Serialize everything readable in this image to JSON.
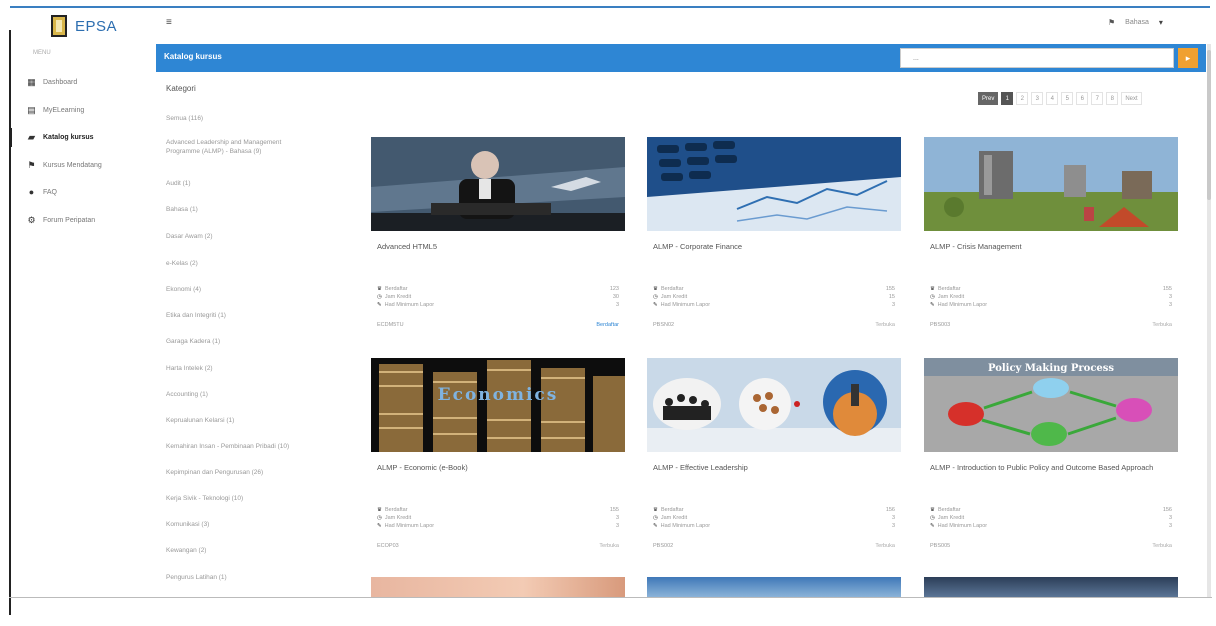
{
  "brand": {
    "name": "EPSA",
    "subtitle": "MENU"
  },
  "nav": [
    {
      "label": "Dashboard",
      "icon": "dashboard-icon",
      "glyph": "▦"
    },
    {
      "label": "MyELearning",
      "icon": "book-icon",
      "glyph": "▤"
    },
    {
      "label": "Katalog kursus",
      "icon": "catalog-icon",
      "glyph": "▰"
    },
    {
      "label": "Kursus Mendatang",
      "icon": "flag-icon",
      "glyph": "⚑"
    },
    {
      "label": "FAQ",
      "icon": "faq-icon",
      "glyph": "●"
    },
    {
      "label": "Forum Peripatan",
      "icon": "forum-icon",
      "glyph": "⚙"
    }
  ],
  "header": {
    "user_label": "Bahasa",
    "flag_glyph": "⚑",
    "caret_glyph": "▾",
    "menu_glyph": "≡"
  },
  "titlebar": {
    "label": "Katalog kursus",
    "search_placeholder": "...",
    "search_glyph": "▸"
  },
  "categories": {
    "heading": "Kategori",
    "items": [
      "Semua (116)",
      "Advanced Leadership and Management Programme (ALMP) - Bahasa (9)",
      "Audit (1)",
      "Bahasa (1)",
      "Dasar Awam (2)",
      "e-Kelas (2)",
      "Ekonomi (4)",
      "Etika dan Integriti (1)",
      "Garaga Kadera (1)",
      "Harta Intelek (2)",
      "Accounting (1)",
      "Keprualunan Kelarsi (1)",
      "Kemahiran Insan - Pembinaan Pribadi (10)",
      "Kepimpinan dan Pengurusan (26)",
      "Kerja Sivik - Teknologi (10)",
      "Komunikasi (3)",
      "Kewangan (2)",
      "Pengurus Latihan (1)"
    ]
  },
  "pagination": {
    "prev": "Prev",
    "pages": [
      "1",
      "2",
      "3",
      "4",
      "5",
      "6",
      "7",
      "8"
    ],
    "next": "Next",
    "active": "1"
  },
  "stat_labels": {
    "enrolled": "Berdaftar",
    "hours": "Jam Kredit",
    "min_score": "Had Minimum Lapor"
  },
  "courses": [
    {
      "title": "Advanced HTML5",
      "enrolled": "123",
      "hours": "30",
      "min_score": "3",
      "code": "ECDM5TU",
      "action": "Berdaftar",
      "action_active": true
    },
    {
      "title": "ALMP - Corporate Finance",
      "enrolled": "155",
      "hours": "15",
      "min_score": "3",
      "code": "PBSN02",
      "action": "Terbuka",
      "action_active": false
    },
    {
      "title": "ALMP - Crisis Management",
      "enrolled": "155",
      "hours": "3",
      "min_score": "3",
      "code": "PBS003",
      "action": "Terbuka",
      "action_active": false
    },
    {
      "title": "ALMP - Economic (e-Book)",
      "enrolled": "155",
      "hours": "3",
      "min_score": "3",
      "code": "ECOP03",
      "action": "Terbuka",
      "action_active": false
    },
    {
      "title": "ALMP - Effective Leadership",
      "enrolled": "156",
      "hours": "3",
      "min_score": "3",
      "code": "PBS002",
      "action": "Terbuka",
      "action_active": false
    },
    {
      "title": "ALMP - Introduction to Public Policy and Outcome Based Approach",
      "enrolled": "156",
      "hours": "3",
      "min_score": "3",
      "code": "PBS005",
      "action": "Terbuka",
      "action_active": false
    }
  ],
  "image_banner_text": {
    "economics": "Economics",
    "policy": "Policy Making Process"
  }
}
